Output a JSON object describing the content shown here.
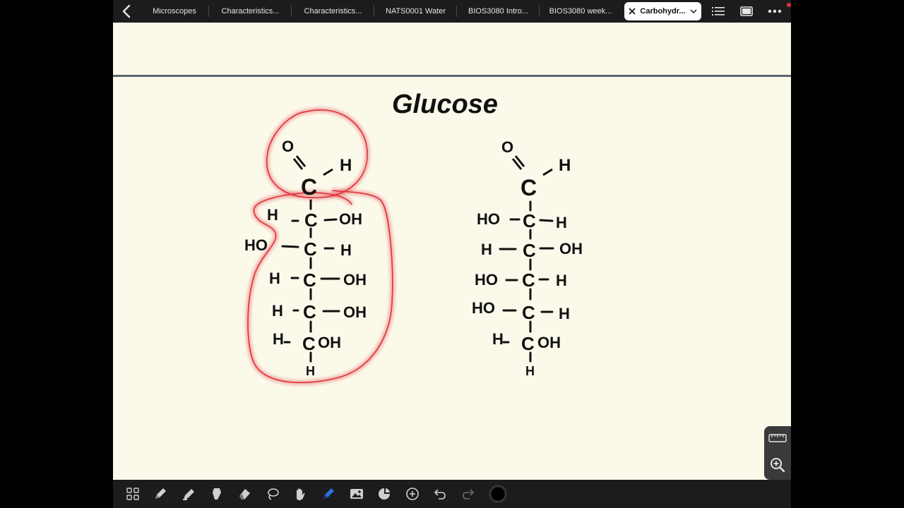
{
  "tabs": [
    {
      "label": "Microscopes"
    },
    {
      "label": "Characteristics..."
    },
    {
      "label": "Characteristics..."
    },
    {
      "label": "NATS0001 Water"
    },
    {
      "label": "BIOS3080 Intro..."
    },
    {
      "label": "BIOS3080 week..."
    },
    {
      "label": "Carbohydr..."
    }
  ],
  "note": {
    "title": "Glucose",
    "left_structure": {
      "top": [
        "O",
        "H",
        "C"
      ],
      "rows": [
        {
          "left": "H",
          "center": "C",
          "right": "OH"
        },
        {
          "left": "HO",
          "center": "C",
          "right": "H"
        },
        {
          "left": "H",
          "center": "C",
          "right": "OH"
        },
        {
          "left": "H",
          "center": "C",
          "right": "OH"
        },
        {
          "left": "H",
          "center": "C",
          "right": "OH"
        }
      ],
      "bottom": "H"
    },
    "right_structure": {
      "top": [
        "O",
        "H",
        "C"
      ],
      "rows": [
        {
          "left": "HO",
          "center": "C",
          "right": "H"
        },
        {
          "left": "H",
          "center": "C",
          "right": "OH"
        },
        {
          "left": "HO",
          "center": "C",
          "right": "H"
        },
        {
          "left": "HO",
          "center": "C",
          "right": "H"
        },
        {
          "left": "H",
          "center": "C",
          "right": "OH"
        }
      ],
      "bottom": "H"
    },
    "highlight_color": "#e0303a",
    "ink_color": "#111111"
  },
  "toolbar_tools": [
    "grid-icon",
    "pen-icon",
    "highlighter-icon",
    "tape-icon",
    "eraser-icon",
    "lasso-icon",
    "hand-icon",
    "active-pen-icon",
    "image-icon",
    "shapes-icon",
    "plus-icon",
    "undo-icon",
    "redo-icon",
    "color-swatch"
  ],
  "accent": "#2f6fd6"
}
